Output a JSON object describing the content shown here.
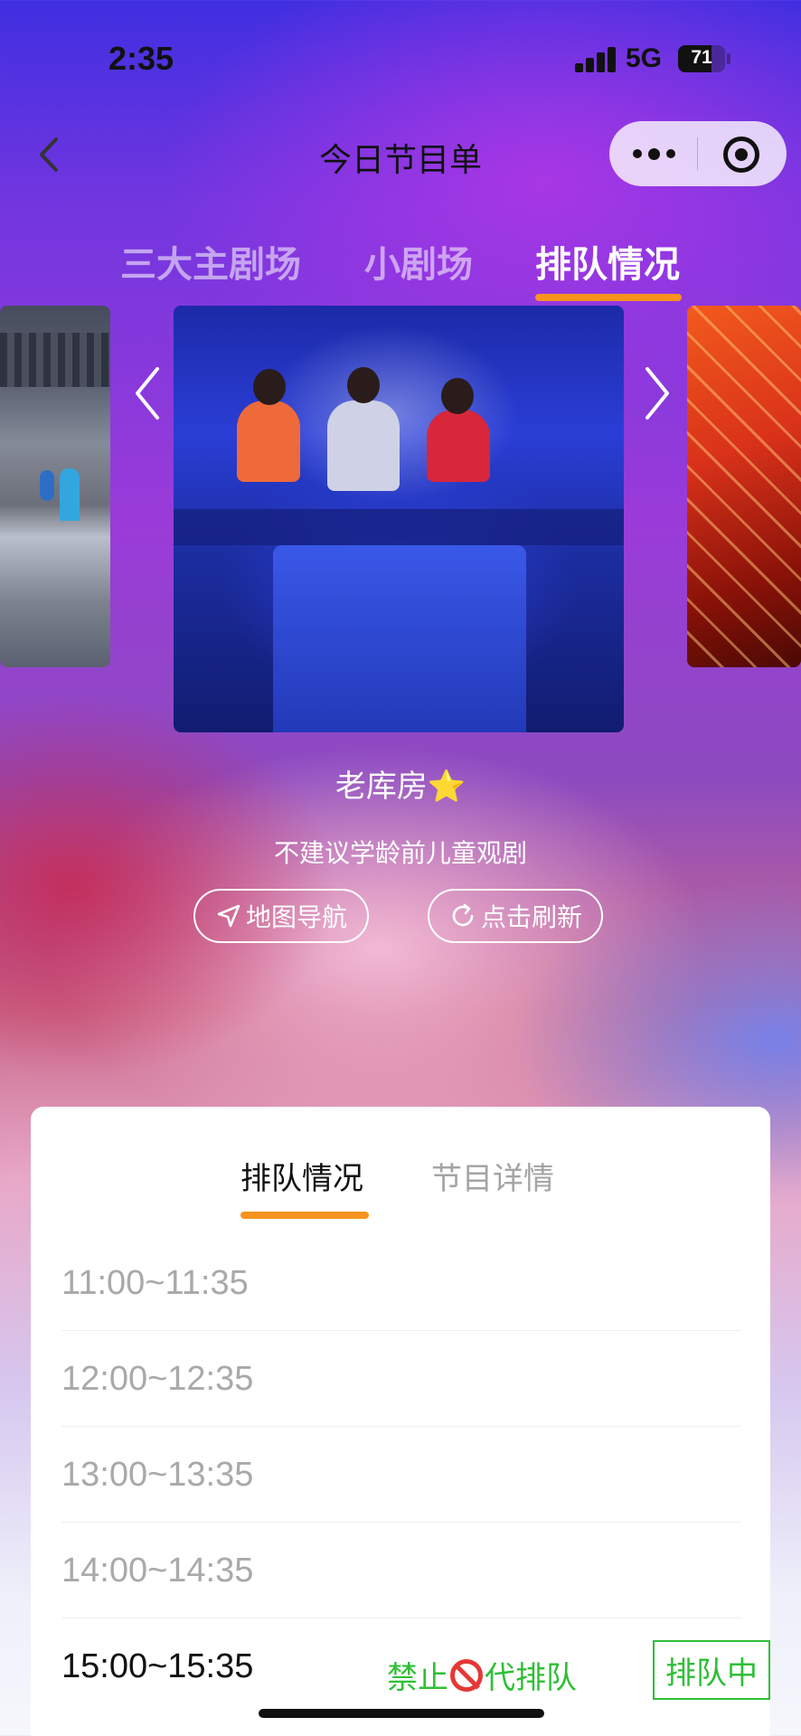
{
  "status_bar": {
    "time": "2:35",
    "network": "5G",
    "battery": "71",
    "battery_level": 0.71
  },
  "nav": {
    "title": "今日节目单",
    "icons": [
      "chevron-left-icon",
      "more-dots-icon",
      "target-close-icon"
    ]
  },
  "top_tabs": [
    {
      "label": "三大主剧场",
      "active": false
    },
    {
      "label": "小剧场",
      "active": false
    },
    {
      "label": "排队情况",
      "active": true
    }
  ],
  "show": {
    "title": "老库房⭐",
    "note": "不建议学龄前儿童观剧",
    "map_button": "地图导航",
    "refresh_button": "点击刷新"
  },
  "card": {
    "tabs": [
      {
        "label": "排队情况",
        "active": true
      },
      {
        "label": "节目详情",
        "active": false
      }
    ],
    "slots": [
      {
        "time": "11:00~11:35"
      },
      {
        "time": "12:00~12:35"
      },
      {
        "time": "13:00~13:35"
      },
      {
        "time": "14:00~14:35"
      },
      {
        "time": "15:00~15:35",
        "warning_pre": "禁止",
        "warning_post": "代排队",
        "status": "排队中"
      }
    ]
  },
  "colors": {
    "accent": "#f7921e",
    "status_green": "#2fbf35",
    "ban_red": "#e53935"
  }
}
